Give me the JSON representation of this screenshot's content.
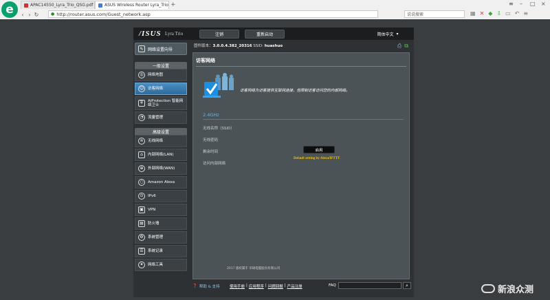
{
  "browser": {
    "tabs": [
      {
        "title": "APAC14550_Lyra_Trio_QSG.pdf"
      },
      {
        "title": "ASUS Wireless Router Lyra_Trio"
      }
    ],
    "address": "http://router.asus.com/Guest_network.asp",
    "search_placeholder": "说说搜索"
  },
  "header": {
    "brand": "/ISUS",
    "model": "Lyra Trio",
    "logout": "注销",
    "reboot": "重新启动",
    "language": "简体中文"
  },
  "firmware": {
    "fw_label": "固件版本：",
    "fw_value": "3.0.0.4.382_20316",
    "ssid_label": "SSID:",
    "ssid_value": "huashuo"
  },
  "sidebar": {
    "qis": "网络设置向导",
    "general_header": "一般设置",
    "general_items": [
      "网络地图",
      "访客网络",
      "AiProtection 智能网络卫士",
      "流量管理"
    ],
    "advanced_header": "高级设置",
    "advanced_items": [
      "无线网络",
      "内部网络(LAN)",
      "外部网络(WAN)",
      "Amazon Alexa",
      "IPv6",
      "VPN",
      "防火墙",
      "系统管理",
      "系统记录",
      "网络工具"
    ]
  },
  "content": {
    "title": "访客网络",
    "intro": "访客网络为访客提供互联网连接，但限制访客访问您的内部网络。",
    "band": "2.4GHz",
    "fields": [
      "无线名称（SSID）",
      "无线密码",
      "剩余时间",
      "访问内部网络"
    ],
    "enable_button": "启用",
    "alexa_note": "Default setting by Alexa/IFTTT"
  },
  "footer": {
    "help": "帮助 & 支持",
    "links": [
      "使用手册",
      "应用程序",
      "问题回报",
      "产品注册"
    ],
    "faq": "FAQ",
    "copyright": "2017 版权属于 华硕电脑股份有限公司"
  },
  "watermark": "新浪众测"
}
